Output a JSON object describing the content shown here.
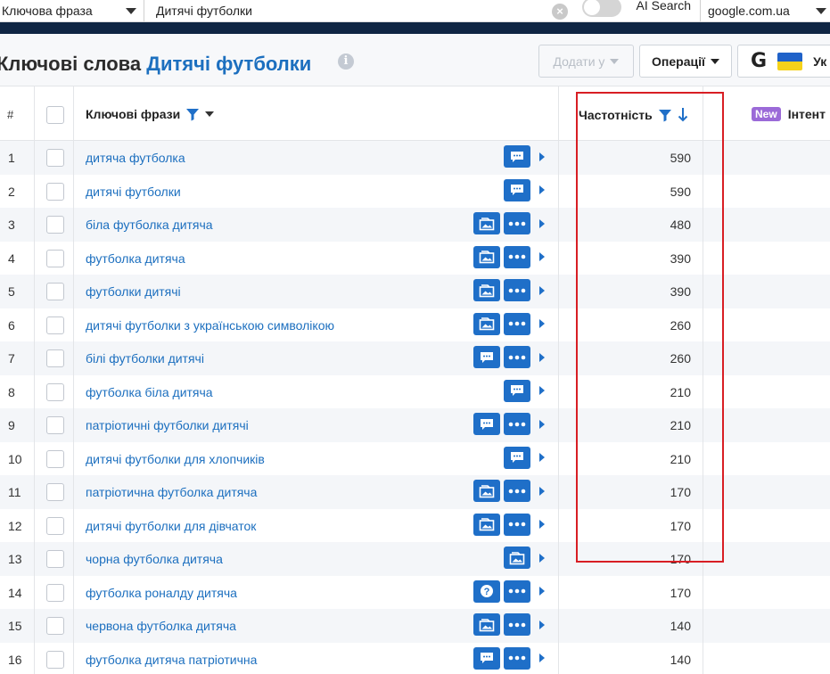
{
  "search": {
    "type_label": "Ключова фраза",
    "query": "Дитячі футболки",
    "ai_search_label": "AI Search",
    "database": "google.com.ua"
  },
  "header": {
    "title_prefix": "Ключові слова",
    "title_keyword": "Дитячі футболки",
    "info_icon": "i",
    "add_button": "Додати у",
    "operations_button": "Операції",
    "google_letter": "G",
    "country_text": "Ук"
  },
  "table": {
    "col_num": "#",
    "col_keywords": "Ключові фрази",
    "col_frequency": "Частотність",
    "new_badge": "New",
    "col_intent": "Інтент",
    "rows": [
      {
        "n": "1",
        "kw": "дитяча футболка",
        "freq": "590",
        "icons": [
          "chat"
        ]
      },
      {
        "n": "2",
        "kw": "дитячі футболки",
        "freq": "590",
        "icons": [
          "chat"
        ]
      },
      {
        "n": "3",
        "kw": "біла футболка дитяча",
        "freq": "480",
        "icons": [
          "image",
          "more"
        ]
      },
      {
        "n": "4",
        "kw": "футболка дитяча",
        "freq": "390",
        "icons": [
          "image",
          "more"
        ]
      },
      {
        "n": "5",
        "kw": "футболки дитячі",
        "freq": "390",
        "icons": [
          "image",
          "more"
        ]
      },
      {
        "n": "6",
        "kw": "дитячі футболки з українською символікою",
        "freq": "260",
        "icons": [
          "image",
          "more"
        ]
      },
      {
        "n": "7",
        "kw": "білі футболки дитячі",
        "freq": "260",
        "icons": [
          "chat",
          "more"
        ]
      },
      {
        "n": "8",
        "kw": "футболка біла дитяча",
        "freq": "210",
        "icons": [
          "chat"
        ]
      },
      {
        "n": "9",
        "kw": "патріотичні футболки дитячі",
        "freq": "210",
        "icons": [
          "chat",
          "more"
        ]
      },
      {
        "n": "10",
        "kw": "дитячі футболки для хлопчиків",
        "freq": "210",
        "icons": [
          "chat"
        ]
      },
      {
        "n": "11",
        "kw": "патріотична футболка дитяча",
        "freq": "170",
        "icons": [
          "image",
          "more"
        ]
      },
      {
        "n": "12",
        "kw": "дитячі футболки для дівчаток",
        "freq": "170",
        "icons": [
          "image",
          "more"
        ]
      },
      {
        "n": "13",
        "kw": "чорна футболка дитяча",
        "freq": "170",
        "icons": [
          "image"
        ]
      },
      {
        "n": "14",
        "kw": "футболка роналду дитяча",
        "freq": "170",
        "icons": [
          "question",
          "more"
        ]
      },
      {
        "n": "15",
        "kw": "червона футболка дитяча",
        "freq": "140",
        "icons": [
          "image",
          "more"
        ]
      },
      {
        "n": "16",
        "kw": "футболка дитяча патріотична",
        "freq": "140",
        "icons": [
          "chat",
          "more"
        ]
      }
    ]
  },
  "colors": {
    "accent": "#1c6fbf",
    "navy": "#0f2543",
    "highlight": "#d81e24",
    "badge": "#9b6ad8"
  }
}
